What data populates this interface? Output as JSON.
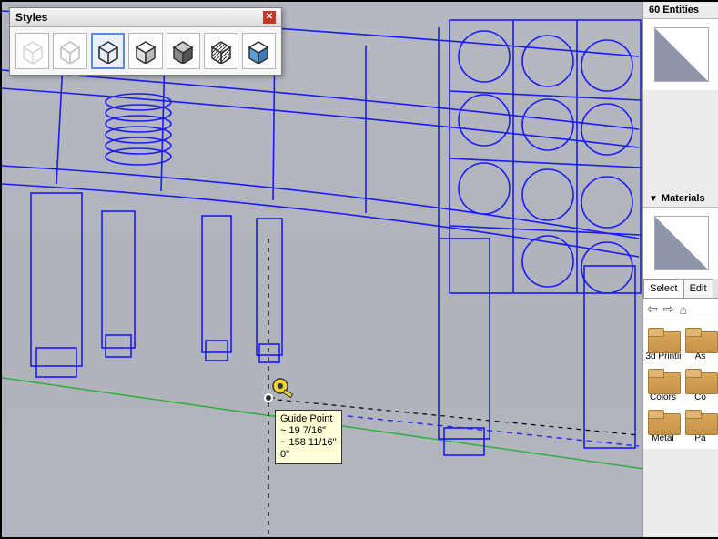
{
  "styles_panel": {
    "title": "Styles",
    "buttons": [
      {
        "name": "style-wireframe-light",
        "selected": false
      },
      {
        "name": "style-hidden-line",
        "selected": false
      },
      {
        "name": "style-shaded-edges",
        "selected": true
      },
      {
        "name": "style-shaded",
        "selected": false
      },
      {
        "name": "style-monochrome",
        "selected": false
      },
      {
        "name": "style-xray",
        "selected": false
      },
      {
        "name": "style-textured",
        "selected": false
      }
    ]
  },
  "tooltip": {
    "title": "Guide Point",
    "line1": "~ 19 7/16\"",
    "line2": "~ 158 11/16\"",
    "line3": "0\""
  },
  "entity_info": {
    "header": "60 Entities"
  },
  "materials": {
    "header": "Materials",
    "tabs": {
      "select": "Select",
      "edit": "Edit"
    },
    "folders": [
      {
        "label": "3d Printin"
      },
      {
        "label": "As"
      },
      {
        "label": "Colors"
      },
      {
        "label": "Co"
      },
      {
        "label": "Metal"
      },
      {
        "label": "Pa"
      }
    ]
  }
}
